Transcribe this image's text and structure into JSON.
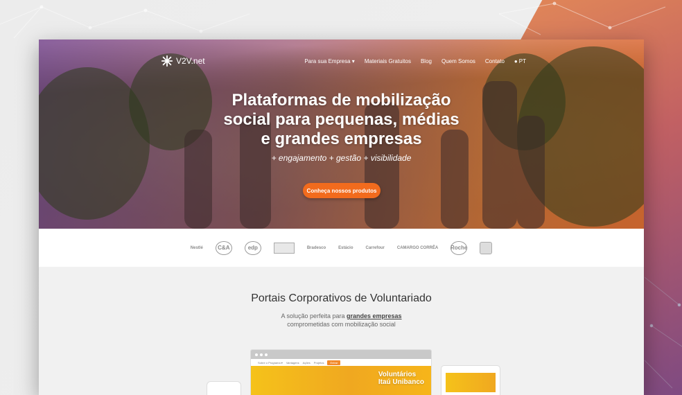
{
  "nav": {
    "logo_text": "V2V.net",
    "items": [
      "Para sua Empresa ▾",
      "Materiais Gratuitos",
      "Blog",
      "Quem Somos",
      "Contato"
    ],
    "language": "PT"
  },
  "hero": {
    "title_lines": [
      "Plataformas de mobilização",
      "social para pequenas, médias",
      "e grandes empresas"
    ],
    "subtitle": "+ engajamento + gestão + visibilidade",
    "cta_label": "Conheça nossos produtos"
  },
  "partners": [
    "Nestlé",
    "C&A",
    "edp",
    "",
    "Bradesco",
    "Estácio",
    "Carrefour",
    "CAMARGO CORRÊA",
    "Roche",
    ""
  ],
  "section": {
    "title": "Portais Corporativos de Voluntariado",
    "sub_prefix": "A solução perfeita para ",
    "sub_bold": "grandes empresas",
    "sub_line2": "comprometidas com mobilização social"
  },
  "mockup": {
    "nav_items": [
      "Sobre o Programa ▾",
      "Vantagens",
      "Ações",
      "Projetos"
    ],
    "nav_button": "Entrar",
    "hero_lines": [
      "Voluntários",
      "Itaú Unibanco"
    ]
  },
  "colors": {
    "accent": "#f26b1d",
    "hero_gradient_start": "#784690",
    "hero_gradient_end": "#eb6e32"
  }
}
